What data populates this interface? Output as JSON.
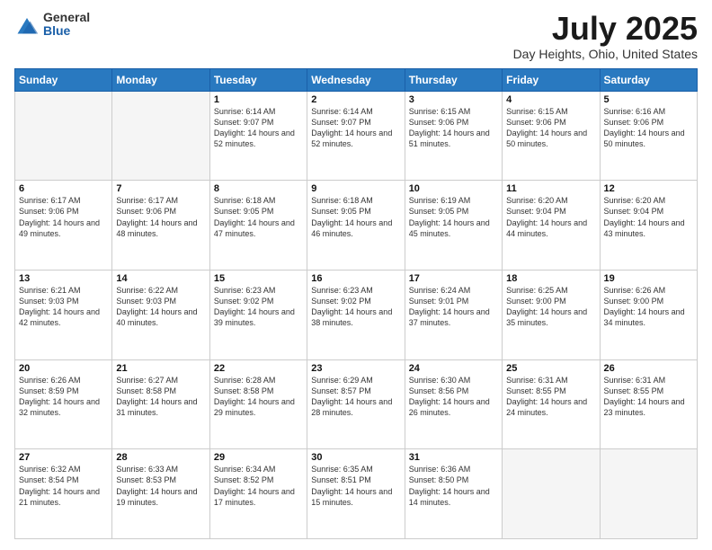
{
  "logo": {
    "general": "General",
    "blue": "Blue"
  },
  "title": "July 2025",
  "subtitle": "Day Heights, Ohio, United States",
  "headers": [
    "Sunday",
    "Monday",
    "Tuesday",
    "Wednesday",
    "Thursday",
    "Friday",
    "Saturday"
  ],
  "weeks": [
    [
      {
        "day": "",
        "sunrise": "",
        "sunset": "",
        "daylight": ""
      },
      {
        "day": "",
        "sunrise": "",
        "sunset": "",
        "daylight": ""
      },
      {
        "day": "1",
        "sunrise": "Sunrise: 6:14 AM",
        "sunset": "Sunset: 9:07 PM",
        "daylight": "Daylight: 14 hours and 52 minutes."
      },
      {
        "day": "2",
        "sunrise": "Sunrise: 6:14 AM",
        "sunset": "Sunset: 9:07 PM",
        "daylight": "Daylight: 14 hours and 52 minutes."
      },
      {
        "day": "3",
        "sunrise": "Sunrise: 6:15 AM",
        "sunset": "Sunset: 9:06 PM",
        "daylight": "Daylight: 14 hours and 51 minutes."
      },
      {
        "day": "4",
        "sunrise": "Sunrise: 6:15 AM",
        "sunset": "Sunset: 9:06 PM",
        "daylight": "Daylight: 14 hours and 50 minutes."
      },
      {
        "day": "5",
        "sunrise": "Sunrise: 6:16 AM",
        "sunset": "Sunset: 9:06 PM",
        "daylight": "Daylight: 14 hours and 50 minutes."
      }
    ],
    [
      {
        "day": "6",
        "sunrise": "Sunrise: 6:17 AM",
        "sunset": "Sunset: 9:06 PM",
        "daylight": "Daylight: 14 hours and 49 minutes."
      },
      {
        "day": "7",
        "sunrise": "Sunrise: 6:17 AM",
        "sunset": "Sunset: 9:06 PM",
        "daylight": "Daylight: 14 hours and 48 minutes."
      },
      {
        "day": "8",
        "sunrise": "Sunrise: 6:18 AM",
        "sunset": "Sunset: 9:05 PM",
        "daylight": "Daylight: 14 hours and 47 minutes."
      },
      {
        "day": "9",
        "sunrise": "Sunrise: 6:18 AM",
        "sunset": "Sunset: 9:05 PM",
        "daylight": "Daylight: 14 hours and 46 minutes."
      },
      {
        "day": "10",
        "sunrise": "Sunrise: 6:19 AM",
        "sunset": "Sunset: 9:05 PM",
        "daylight": "Daylight: 14 hours and 45 minutes."
      },
      {
        "day": "11",
        "sunrise": "Sunrise: 6:20 AM",
        "sunset": "Sunset: 9:04 PM",
        "daylight": "Daylight: 14 hours and 44 minutes."
      },
      {
        "day": "12",
        "sunrise": "Sunrise: 6:20 AM",
        "sunset": "Sunset: 9:04 PM",
        "daylight": "Daylight: 14 hours and 43 minutes."
      }
    ],
    [
      {
        "day": "13",
        "sunrise": "Sunrise: 6:21 AM",
        "sunset": "Sunset: 9:03 PM",
        "daylight": "Daylight: 14 hours and 42 minutes."
      },
      {
        "day": "14",
        "sunrise": "Sunrise: 6:22 AM",
        "sunset": "Sunset: 9:03 PM",
        "daylight": "Daylight: 14 hours and 40 minutes."
      },
      {
        "day": "15",
        "sunrise": "Sunrise: 6:23 AM",
        "sunset": "Sunset: 9:02 PM",
        "daylight": "Daylight: 14 hours and 39 minutes."
      },
      {
        "day": "16",
        "sunrise": "Sunrise: 6:23 AM",
        "sunset": "Sunset: 9:02 PM",
        "daylight": "Daylight: 14 hours and 38 minutes."
      },
      {
        "day": "17",
        "sunrise": "Sunrise: 6:24 AM",
        "sunset": "Sunset: 9:01 PM",
        "daylight": "Daylight: 14 hours and 37 minutes."
      },
      {
        "day": "18",
        "sunrise": "Sunrise: 6:25 AM",
        "sunset": "Sunset: 9:00 PM",
        "daylight": "Daylight: 14 hours and 35 minutes."
      },
      {
        "day": "19",
        "sunrise": "Sunrise: 6:26 AM",
        "sunset": "Sunset: 9:00 PM",
        "daylight": "Daylight: 14 hours and 34 minutes."
      }
    ],
    [
      {
        "day": "20",
        "sunrise": "Sunrise: 6:26 AM",
        "sunset": "Sunset: 8:59 PM",
        "daylight": "Daylight: 14 hours and 32 minutes."
      },
      {
        "day": "21",
        "sunrise": "Sunrise: 6:27 AM",
        "sunset": "Sunset: 8:58 PM",
        "daylight": "Daylight: 14 hours and 31 minutes."
      },
      {
        "day": "22",
        "sunrise": "Sunrise: 6:28 AM",
        "sunset": "Sunset: 8:58 PM",
        "daylight": "Daylight: 14 hours and 29 minutes."
      },
      {
        "day": "23",
        "sunrise": "Sunrise: 6:29 AM",
        "sunset": "Sunset: 8:57 PM",
        "daylight": "Daylight: 14 hours and 28 minutes."
      },
      {
        "day": "24",
        "sunrise": "Sunrise: 6:30 AM",
        "sunset": "Sunset: 8:56 PM",
        "daylight": "Daylight: 14 hours and 26 minutes."
      },
      {
        "day": "25",
        "sunrise": "Sunrise: 6:31 AM",
        "sunset": "Sunset: 8:55 PM",
        "daylight": "Daylight: 14 hours and 24 minutes."
      },
      {
        "day": "26",
        "sunrise": "Sunrise: 6:31 AM",
        "sunset": "Sunset: 8:55 PM",
        "daylight": "Daylight: 14 hours and 23 minutes."
      }
    ],
    [
      {
        "day": "27",
        "sunrise": "Sunrise: 6:32 AM",
        "sunset": "Sunset: 8:54 PM",
        "daylight": "Daylight: 14 hours and 21 minutes."
      },
      {
        "day": "28",
        "sunrise": "Sunrise: 6:33 AM",
        "sunset": "Sunset: 8:53 PM",
        "daylight": "Daylight: 14 hours and 19 minutes."
      },
      {
        "day": "29",
        "sunrise": "Sunrise: 6:34 AM",
        "sunset": "Sunset: 8:52 PM",
        "daylight": "Daylight: 14 hours and 17 minutes."
      },
      {
        "day": "30",
        "sunrise": "Sunrise: 6:35 AM",
        "sunset": "Sunset: 8:51 PM",
        "daylight": "Daylight: 14 hours and 15 minutes."
      },
      {
        "day": "31",
        "sunrise": "Sunrise: 6:36 AM",
        "sunset": "Sunset: 8:50 PM",
        "daylight": "Daylight: 14 hours and 14 minutes."
      },
      {
        "day": "",
        "sunrise": "",
        "sunset": "",
        "daylight": ""
      },
      {
        "day": "",
        "sunrise": "",
        "sunset": "",
        "daylight": ""
      }
    ]
  ]
}
